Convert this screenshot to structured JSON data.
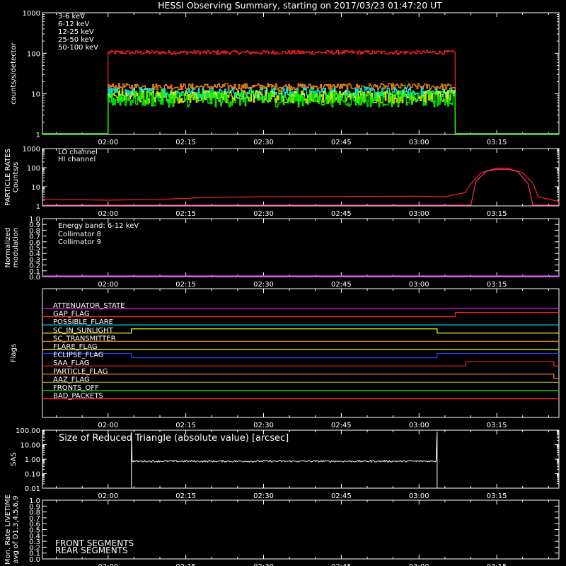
{
  "title": "HESSI Observing Summary, starting on 2017/03/23 01:47:20 UT",
  "time_axis": {
    "start": "01:47:20",
    "end": "03:27:00",
    "ticks": [
      "02:00",
      "02:15",
      "02:30",
      "02:45",
      "03:00",
      "03:15"
    ]
  },
  "chart_data": [
    {
      "type": "line",
      "panel": "count-rates",
      "ylabel": "counts/s/detector",
      "yscale": "log",
      "ylim": [
        1,
        1000
      ],
      "yticks": [
        "1",
        "10",
        "100",
        "1000"
      ],
      "interval": [
        "02:00",
        "03:07"
      ],
      "series": [
        {
          "name": "3-6 keV",
          "color": "#ff2020",
          "level": 105,
          "noise": 0.05
        },
        {
          "name": "6-12 keV",
          "color": "#ff8c1a",
          "level": 15,
          "noise": 0.08
        },
        {
          "name": "12-25 keV",
          "color": "#ffff00",
          "level": 8.5,
          "noise": 0.16
        },
        {
          "name": "25-50 keV",
          "color": "#00ff00",
          "level": 7.5,
          "noise": 0.2
        },
        {
          "name": "50-100 keV",
          "color": "#00ffff",
          "level": 10.5,
          "noise": 0.14
        }
      ]
    },
    {
      "type": "line",
      "panel": "particle-rates",
      "ylabel": "PARTICLE RATES",
      "ylabel2": "Counts/s",
      "yscale": "log",
      "ylim": [
        1,
        1000
      ],
      "yticks": [
        "1",
        "10",
        "100",
        "1000"
      ],
      "series": [
        {
          "name": "LO channel",
          "color": "#ff2020",
          "points": [
            [
              "01:47:20",
              2.3
            ],
            [
              "01:50",
              2.2
            ],
            [
              "02:00",
              2
            ],
            [
              "02:10",
              2.2
            ],
            [
              "02:20",
              2.8
            ],
            [
              "02:30",
              3
            ],
            [
              "02:45",
              3.1
            ],
            [
              "03:00",
              3.2
            ],
            [
              "03:05",
              3
            ],
            [
              "03:09",
              5
            ],
            [
              "03:10",
              15
            ],
            [
              "03:12",
              55
            ],
            [
              "03:15",
              95
            ],
            [
              "03:17",
              95
            ],
            [
              "03:20",
              55
            ],
            [
              "03:22",
              15
            ],
            [
              "03:23",
              3
            ],
            [
              "03:27",
              1.7
            ]
          ]
        },
        {
          "name": "HI channel",
          "color": "#ff2d78",
          "points": [
            [
              "01:47:20",
              1
            ],
            [
              "03:10",
              1
            ],
            [
              "03:11",
              20
            ],
            [
              "03:13",
              65
            ],
            [
              "03:15",
              82
            ],
            [
              "03:17",
              82
            ],
            [
              "03:19",
              65
            ],
            [
              "03:21",
              15
            ],
            [
              "03:22",
              1
            ],
            [
              "03:27",
              1
            ]
          ]
        }
      ]
    },
    {
      "type": "line",
      "panel": "modulation",
      "ylabel": "Normalized",
      "ylabel2": "modulation",
      "ylim": [
        0,
        1
      ],
      "yticks": [
        "0.0",
        "0.1",
        "0.2",
        "0.3",
        "0.4",
        "0.5",
        "0.6",
        "0.7",
        "0.8",
        "0.9",
        "1.0"
      ],
      "annotation": "Energy band: 6-12 keV",
      "series": [
        {
          "name": "Collimator 8",
          "color": "#00ffff",
          "value": 0
        },
        {
          "name": "Collimator 9",
          "color": "#ff00ff",
          "value": 0
        }
      ]
    },
    {
      "type": "line",
      "panel": "flags",
      "ylabel": "Flags",
      "series": [
        {
          "name": "ATTENUATOR_STATE",
          "color": "#ff00ff",
          "segments": [
            [
              "01:47:20",
              "03:27:00",
              0
            ]
          ]
        },
        {
          "name": "GAP_FLAG",
          "color": "#ff2020",
          "segments": [
            [
              "01:47:20",
              "03:07:00",
              0
            ],
            [
              "03:07:00",
              "03:27:00",
              1
            ]
          ]
        },
        {
          "name": "POSSIBLE_FLARE",
          "color": "#00ffff",
          "segments": [
            [
              "01:47:20",
              "03:27:00",
              0
            ]
          ]
        },
        {
          "name": "SC_IN_SUNLIGHT",
          "color": "#ffff00",
          "segments": [
            [
              "01:47:20",
              "02:04:30",
              0
            ],
            [
              "02:04:30",
              "03:03:30",
              1
            ],
            [
              "03:03:30",
              "03:27:00",
              0
            ]
          ]
        },
        {
          "name": "SC_TRANSMITTER",
          "color": "#ff8c1a",
          "segments": [
            [
              "01:47:20",
              "03:27:00",
              0
            ]
          ]
        },
        {
          "name": "FLARE_FLAG",
          "color": "#ffff40",
          "segments": [
            [
              "01:47:20",
              "03:27:00",
              0
            ]
          ]
        },
        {
          "name": "ECLIPSE_FLAG",
          "color": "#2040ff",
          "segments": [
            [
              "01:47:20",
              "02:04:30",
              1
            ],
            [
              "02:04:30",
              "03:03:30",
              0
            ],
            [
              "03:03:30",
              "03:27:00",
              1
            ]
          ]
        },
        {
          "name": "SAA_FLAG",
          "color": "#ff2020",
          "segments": [
            [
              "01:47:20",
              "03:09:00",
              0
            ],
            [
              "03:09:00",
              "03:26:00",
              1
            ],
            [
              "03:26:00",
              "03:27:00",
              0
            ]
          ]
        },
        {
          "name": "PARTICLE_FLAG",
          "color": "#ff8c1a",
          "segments": [
            [
              "01:47:20",
              "03:26:00",
              0
            ],
            [
              "03:26:00",
              "03:27:00",
              -1
            ]
          ]
        },
        {
          "name": "AAZ_FLAG",
          "color": "#a0a020",
          "segments": [
            [
              "01:47:20",
              "03:27:00",
              0
            ]
          ]
        },
        {
          "name": "FRONTS_OFF",
          "color": "#00ff00",
          "segments": [
            [
              "01:47:20",
              "03:27:00",
              0
            ]
          ]
        },
        {
          "name": "BAD_PACKETS",
          "color": "#ff2020",
          "segments": [
            [
              "01:47:20",
              "03:27:00",
              0
            ]
          ]
        }
      ]
    },
    {
      "type": "line",
      "panel": "sas",
      "ylabel": "SAS",
      "yscale": "log",
      "ylim": [
        0.01,
        100
      ],
      "yticks": [
        "0.01",
        "0.10",
        "1.00",
        "10.00",
        "100.00"
      ],
      "annotation": "Size of Reduced Triangle (absolute value) [arcsec]",
      "series": [
        {
          "name": "",
          "color": "#ffffff",
          "level": 0.72,
          "interval": [
            "02:04:30",
            "03:03:30"
          ]
        }
      ]
    },
    {
      "type": "line",
      "panel": "livetime",
      "ylabel": "Mon. Rate LIVETIME",
      "ylabel2": "avg of D1,3,4,5,6,9",
      "ylim": [
        0,
        1
      ],
      "yticks": [
        "0.0",
        "0.1",
        "0.2",
        "0.3",
        "0.4",
        "0.5",
        "0.6",
        "0.7",
        "0.8",
        "0.9",
        "1.0"
      ],
      "series": [
        {
          "name": "FRONT SEGMENTS",
          "color": "#00ff00"
        },
        {
          "name": "REAR SEGMENTS",
          "color": "#00a000"
        }
      ]
    }
  ]
}
